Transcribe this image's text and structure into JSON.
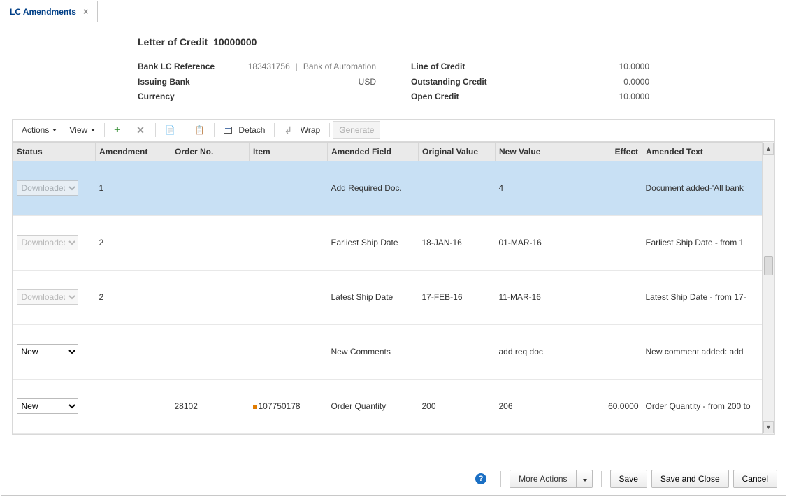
{
  "tab": {
    "label": "LC Amendments"
  },
  "header": {
    "title_prefix": "Letter of Credit",
    "lc_id": "10000000",
    "left": {
      "bank_lc_ref_label": "Bank LC Reference",
      "bank_lc_ref_value": "183431756",
      "bank_name": "Bank of Automation",
      "issuing_bank_label": "Issuing Bank",
      "issuing_bank_value": "USD",
      "currency_label": "Currency",
      "currency_value": ""
    },
    "right": {
      "line_label": "Line of Credit",
      "line_value": "10.0000",
      "outstanding_label": "Outstanding Credit",
      "outstanding_value": "0.0000",
      "open_label": "Open Credit",
      "open_value": "10.0000"
    }
  },
  "toolbar": {
    "actions": "Actions",
    "view": "View",
    "detach": "Detach",
    "wrap": "Wrap",
    "generate": "Generate"
  },
  "columns": {
    "status": "Status",
    "amendment": "Amendment",
    "order": "Order No.",
    "item": "Item",
    "amended_field": "Amended Field",
    "original": "Original Value",
    "new": "New Value",
    "effect": "Effect",
    "amended_text": "Amended Text"
  },
  "status_options": {
    "downloaded": "Downloaded",
    "new": "New"
  },
  "rows": [
    {
      "status": "Downloaded",
      "disabled": true,
      "amendment": "1",
      "order": "",
      "item": "",
      "field": "Add Required Doc.",
      "orig": "",
      "newv": "4",
      "effect": "",
      "text": "Document added-'All bank",
      "selected": true
    },
    {
      "status": "Downloaded",
      "disabled": true,
      "amendment": "2",
      "order": "",
      "item": "",
      "field": "Earliest Ship Date",
      "orig": "18-JAN-16",
      "newv": "01-MAR-16",
      "effect": "",
      "text": "Earliest Ship Date - from 1"
    },
    {
      "status": "Downloaded",
      "disabled": true,
      "amendment": "2",
      "order": "",
      "item": "",
      "field": "Latest Ship Date",
      "orig": "17-FEB-16",
      "newv": "11-MAR-16",
      "effect": "",
      "text": "Latest Ship Date - from 17-"
    },
    {
      "status": "New",
      "disabled": false,
      "amendment": "",
      "order": "",
      "item": "",
      "field": "New Comments",
      "orig": "",
      "newv": "add req doc",
      "effect": "",
      "text": "New comment added: add"
    },
    {
      "status": "New",
      "disabled": false,
      "amendment": "",
      "order": "28102",
      "item": "107750178",
      "field": "Order Quantity",
      "orig": "200",
      "newv": "206",
      "effect": "60.0000",
      "text": "Order Quantity - from 200 to"
    }
  ],
  "footer": {
    "more": "More Actions",
    "save": "Save",
    "save_close": "Save and Close",
    "cancel": "Cancel"
  }
}
